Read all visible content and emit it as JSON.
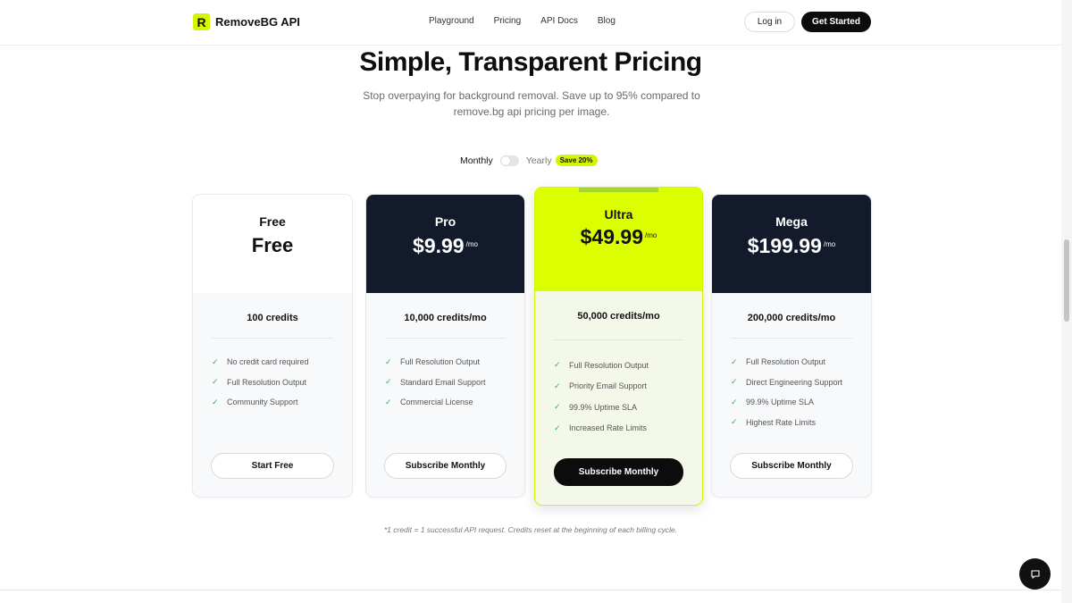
{
  "header": {
    "logo_letter": "R",
    "brand": "RemoveBG API",
    "nav": [
      "Playground",
      "Pricing",
      "API Docs",
      "Blog"
    ],
    "login_label": "Log in",
    "get_started_label": "Get Started"
  },
  "hero": {
    "title": "Simple, Transparent Pricing",
    "subtitle": "Stop overpaying for background removal. Save up to 95% compared to remove.bg api pricing per image."
  },
  "billing": {
    "monthly_label": "Monthly",
    "yearly_label": "Yearly",
    "save_badge": "Save 20%",
    "yearly_enabled": false
  },
  "plans": [
    {
      "name": "Free",
      "price": "Free",
      "per": "",
      "credits": "100 credits",
      "features": [
        "No credit card required",
        "Full Resolution Output",
        "Community Support"
      ],
      "cta": "Start Free"
    },
    {
      "name": "Pro",
      "price": "$9.99",
      "per": "/mo",
      "credits": "10,000 credits/mo",
      "features": [
        "Full Resolution Output",
        "Standard Email Support",
        "Commercial License"
      ],
      "cta": "Subscribe Monthly"
    },
    {
      "name": "Ultra",
      "price": "$49.99",
      "per": "/mo",
      "credits": "50,000 credits/mo",
      "features": [
        "Full Resolution Output",
        "Priority Email Support",
        "99.9% Uptime SLA",
        "Increased Rate Limits"
      ],
      "cta": "Subscribe Monthly"
    },
    {
      "name": "Mega",
      "price": "$199.99",
      "per": "/mo",
      "credits": "200,000 credits/mo",
      "features": [
        "Full Resolution Output",
        "Direct Engineering Support",
        "99.9% Uptime SLA",
        "Highest Rate Limits"
      ],
      "cta": "Subscribe Monthly"
    }
  ],
  "footnote": "*1 credit = 1 successful API request. Credits reset at the beginning of each billing cycle.",
  "colors": {
    "accent": "#dcff00",
    "dark_card": "#121a2b",
    "check": "#2bb34b"
  },
  "icons": {
    "check": "check-icon",
    "chat": "chat-bubble-icon"
  }
}
